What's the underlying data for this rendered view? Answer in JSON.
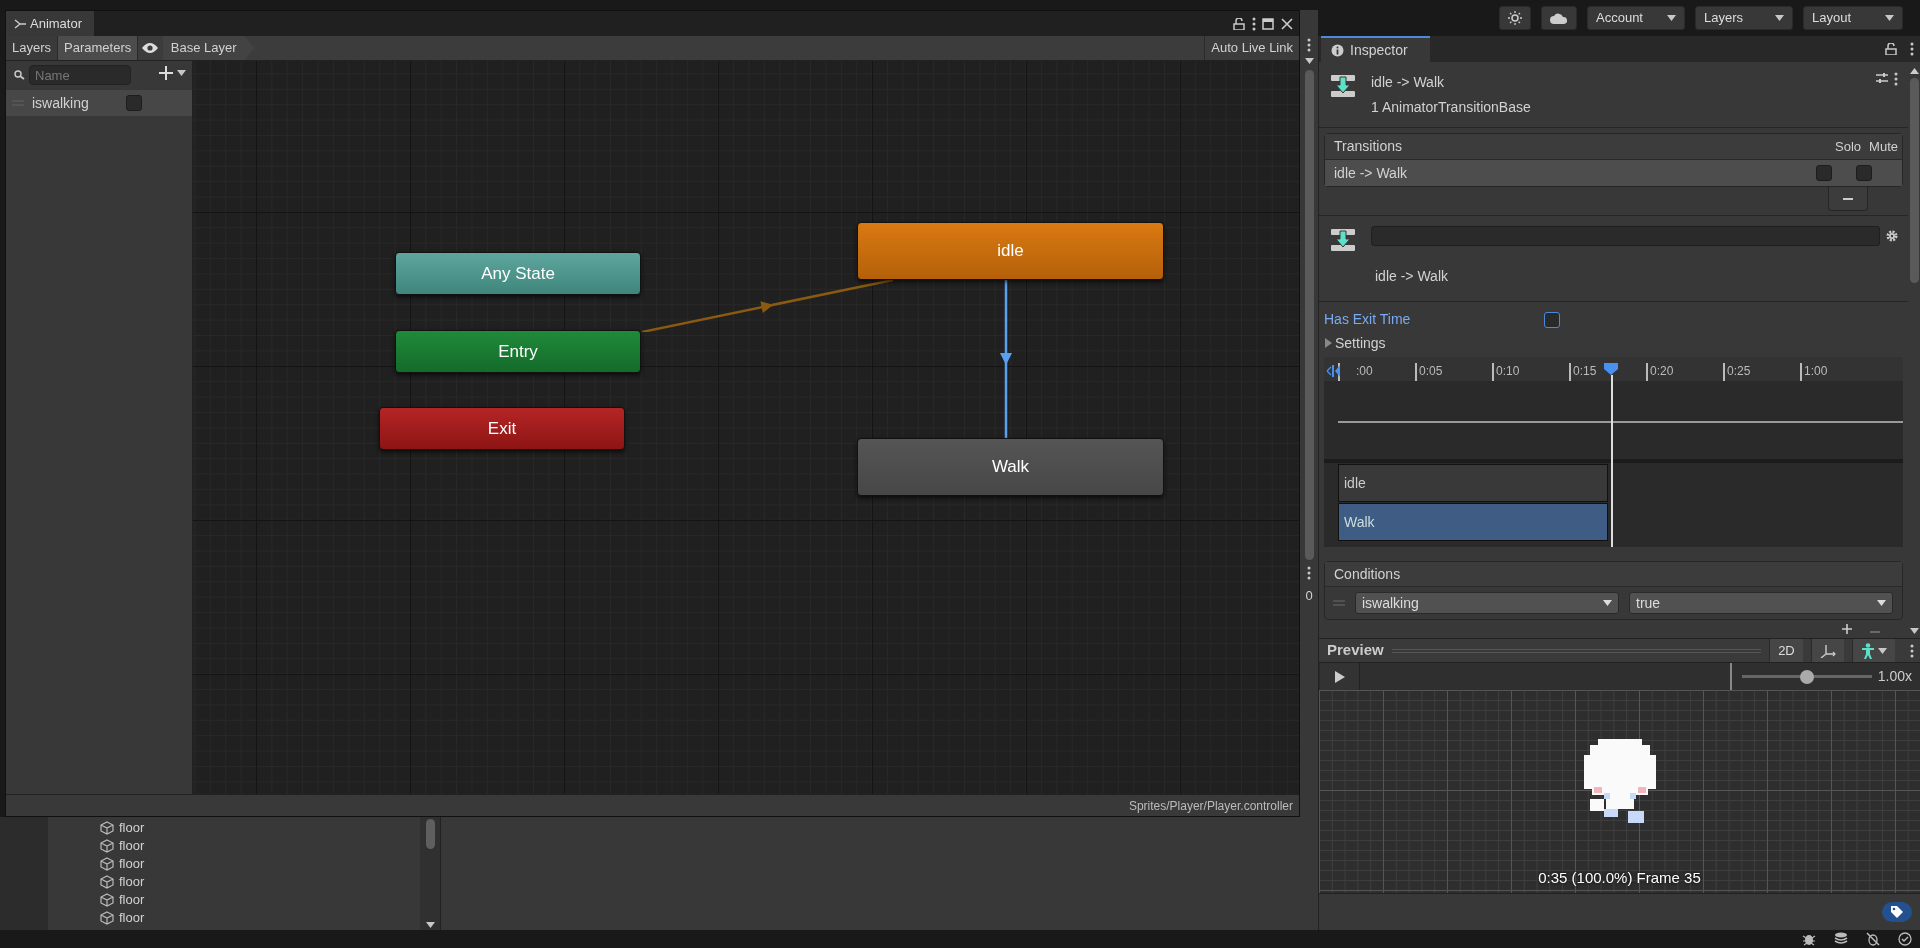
{
  "toolbar": {
    "buttons": [
      {
        "label": "Account"
      },
      {
        "label": "Layers"
      },
      {
        "label": "Layout"
      }
    ]
  },
  "animator": {
    "title": "Animator",
    "tabs": [
      {
        "label": "Layers",
        "selected": false
      },
      {
        "label": "Parameters",
        "selected": true
      }
    ],
    "breadcrumb": "Base Layer",
    "live_link": {
      "label": "Auto Live Link",
      "on": false
    },
    "search": {
      "placeholder": "Name"
    },
    "parameters": [
      {
        "name": "iswalking",
        "checked": false
      }
    ],
    "states": [
      {
        "label": "Any State",
        "kind": "any"
      },
      {
        "label": "Entry",
        "kind": "entry"
      },
      {
        "label": "Exit",
        "kind": "exit"
      },
      {
        "label": "idle",
        "kind": "default"
      },
      {
        "label": "Walk",
        "kind": "normal"
      }
    ],
    "transitions": [
      {
        "selected": false
      },
      {
        "selected": true
      }
    ],
    "path": "Sprites/Player/Player.controller"
  },
  "side_panel": {
    "value": "0"
  },
  "hierarchy": {
    "items": [
      "floor",
      "floor",
      "floor",
      "floor",
      "floor",
      "floor"
    ]
  },
  "inspector": {
    "tab": "Inspector",
    "header": {
      "title": "idle -> Walk",
      "subtitle": "1 AnimatorTransitionBase"
    },
    "transitions": {
      "heading": "Transitions",
      "columns": [
        "Solo",
        "Mute"
      ],
      "rows": [
        {
          "name": "idle -> Walk",
          "solo": false,
          "mute": false,
          "selected": true
        }
      ]
    },
    "transition": {
      "label": "idle -> Walk"
    },
    "has_exit_time": {
      "label": "Has Exit Time",
      "checked": false
    },
    "settings": {
      "label": "Settings",
      "expanded": false
    },
    "timeline": {
      "ticks": [
        ":00",
        "0:05",
        "0:10",
        "0:15",
        "0:20",
        "0:25",
        "1:00"
      ],
      "tracks": [
        {
          "label": "idle",
          "selected": false
        },
        {
          "label": "Walk",
          "selected": true
        }
      ]
    },
    "conditions": {
      "heading": "Conditions",
      "rows": [
        {
          "parameter": "iswalking",
          "value": "true"
        }
      ]
    },
    "preview": {
      "title": "Preview",
      "mode": "2D",
      "speed": {
        "level": 0.5,
        "reading": "1.00x"
      },
      "caption": "0:35 (100.0%) Frame 35"
    }
  }
}
